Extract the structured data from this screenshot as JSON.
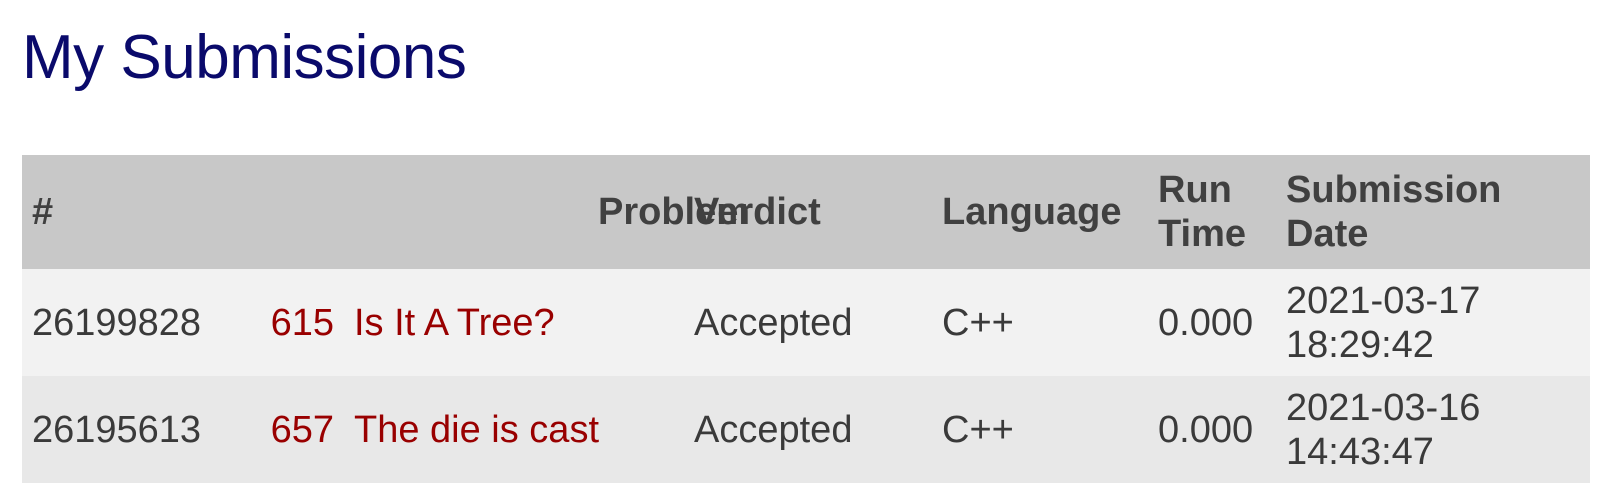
{
  "page": {
    "title": "My Submissions"
  },
  "table": {
    "headers": {
      "id": "#",
      "problem": "Problem",
      "verdict": "Verdict",
      "language": "Language",
      "run_time_line1": "Run",
      "run_time_line2": "Time",
      "date_line1": "Submission",
      "date_line2": "Date"
    },
    "rows": [
      {
        "id": "26199828",
        "problem_id": "615",
        "problem_name": "Is It A Tree?",
        "verdict": "Accepted",
        "language": "C++",
        "run_time": "0.000",
        "date": "2021-03-17",
        "time": "18:29:42"
      },
      {
        "id": "26195613",
        "problem_id": "657",
        "problem_name": "The die is cast",
        "verdict": "Accepted",
        "language": "C++",
        "run_time": "0.000",
        "date": "2021-03-16",
        "time": "14:43:47"
      }
    ]
  },
  "colors": {
    "title": "#0a0a6b",
    "header_bg": "#c8c8c8",
    "row_odd_bg": "#f2f2f2",
    "row_even_bg": "#e8e8e8",
    "problem_link": "#990000"
  }
}
